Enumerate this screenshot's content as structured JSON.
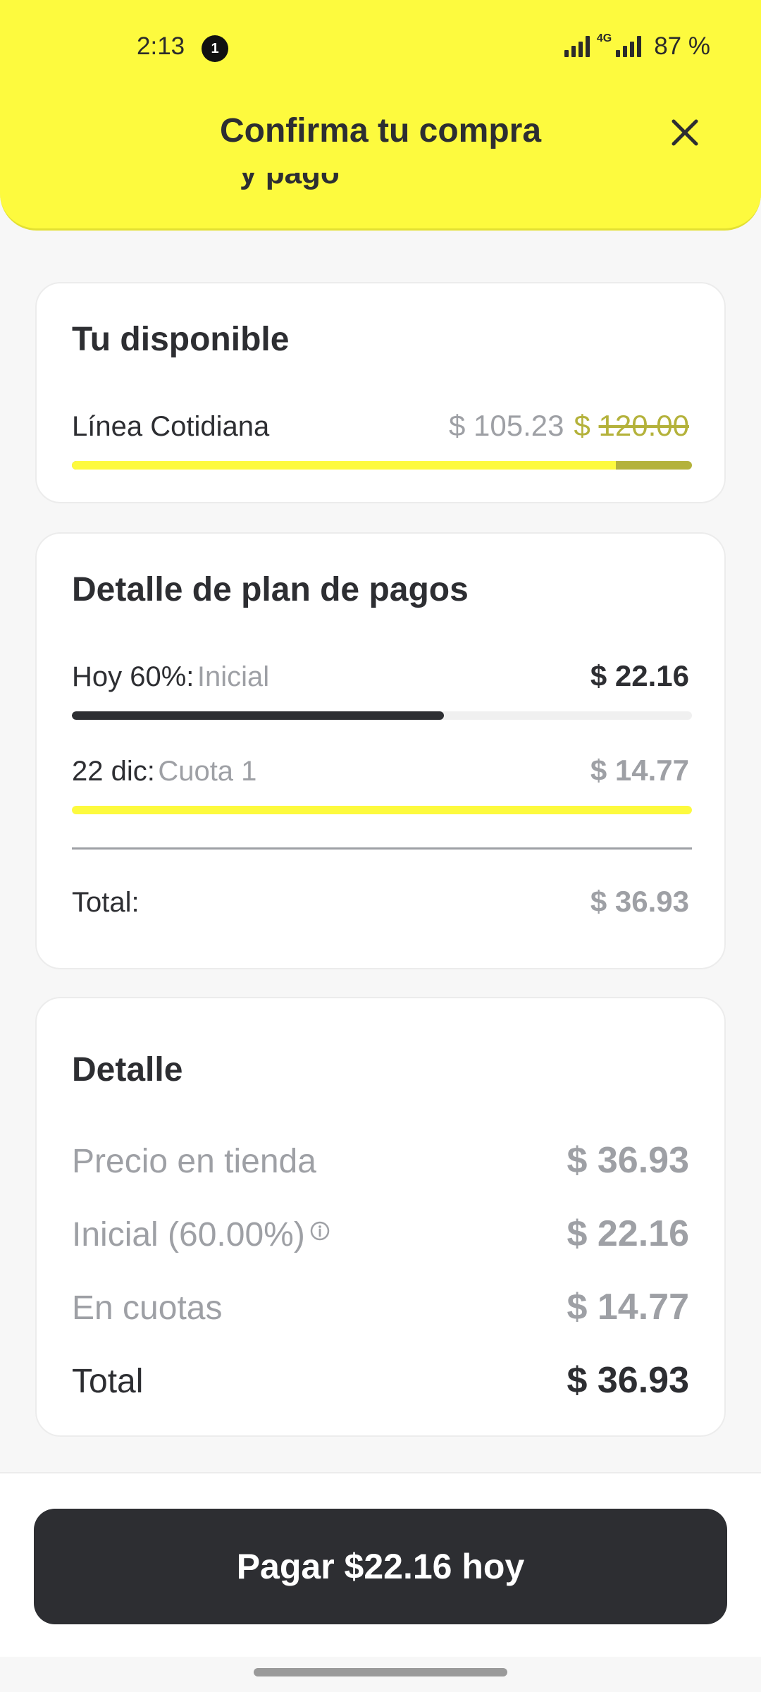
{
  "status_bar": {
    "time": "2:13",
    "notification_count": "1",
    "network_label": "4G",
    "battery": "87 %"
  },
  "header": {
    "title": "Confirma tu compra",
    "peek_text": "y pago",
    "close_icon": "close-icon",
    "background_color": "#fdfa3e"
  },
  "available": {
    "title": "Tu disponible",
    "line_label": "Línea Cotidiana",
    "available_amount": "$ 105.23",
    "total_prefix": "$ ",
    "total_amount": "120.00",
    "available_fraction": 0.877
  },
  "payment_plan": {
    "title": "Detalle de plan de pagos",
    "installments": [
      {
        "date": "Hoy 60%:",
        "label": "Inicial",
        "amount": "$ 22.16",
        "progress": 0.6
      },
      {
        "date": "22 dic:",
        "label": "Cuota 1",
        "amount": "$ 14.77",
        "progress": 1.0
      }
    ],
    "total_label": "Total:",
    "total_value": "$ 36.93"
  },
  "detail": {
    "title": "Detalle",
    "store_price_label": "Precio en tienda",
    "store_price_value": "$ 36.93",
    "initial_label": "Inicial (60.00%)",
    "initial_value": "$ 22.16",
    "installments_label": "En cuotas",
    "installments_value": "$ 14.77",
    "total_label": "Total",
    "total_value": "$ 36.93",
    "info_icon": "info-icon"
  },
  "footer": {
    "pay_button_label": "Pagar $22.16 hoy"
  },
  "colors": {
    "accent_yellow": "#fdfa3e",
    "dark": "#2d2e32",
    "muted": "#9ea0a5",
    "olive": "#b4b23b"
  }
}
